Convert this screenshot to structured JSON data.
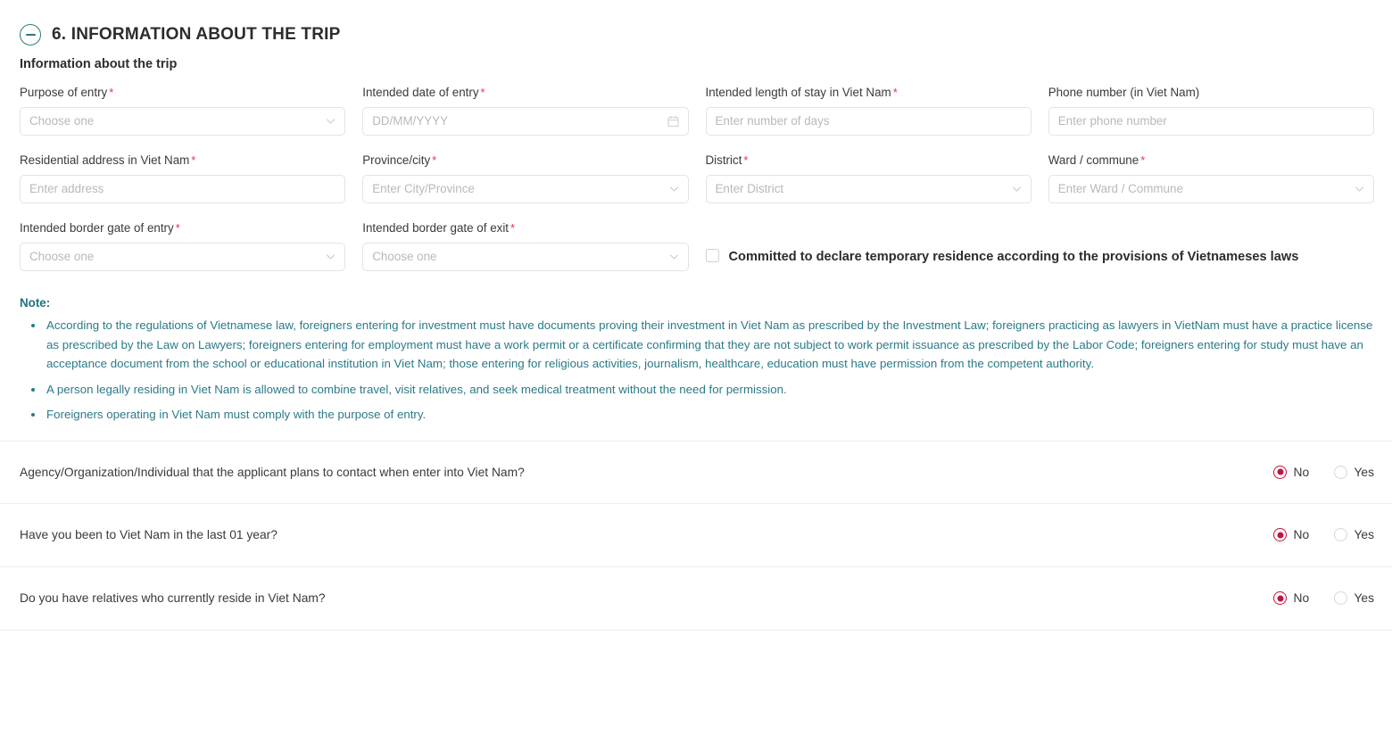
{
  "section": {
    "number_title": "6. INFORMATION ABOUT THE TRIP",
    "collapse_icon": "circle-minus-icon",
    "accent_color": "#2c7a7b",
    "subtitle": "Information about the trip"
  },
  "fields": [
    {
      "label": "Purpose of entry",
      "required": true,
      "type": "select",
      "placeholder": "Choose one",
      "value": "",
      "name": "purpose-of-entry"
    },
    {
      "label": "Intended date of entry",
      "required": true,
      "type": "date",
      "placeholder": "DD/MM/YYYY",
      "value": "",
      "name": "intended-date-of-entry"
    },
    {
      "label": "Intended length of stay in Viet Nam",
      "required": true,
      "type": "text",
      "placeholder": "Enter number of days",
      "value": "",
      "name": "intended-length-of-stay"
    },
    {
      "label": "Phone number (in Viet Nam)",
      "required": false,
      "type": "text",
      "placeholder": "Enter phone number",
      "value": "",
      "name": "phone-number-in-viet-nam"
    },
    {
      "label": "Residential address in Viet Nam",
      "required": true,
      "type": "text",
      "placeholder": "Enter address",
      "value": "",
      "name": "residential-address"
    },
    {
      "label": "Province/city",
      "required": true,
      "type": "select",
      "placeholder": "Enter City/Province",
      "value": "",
      "name": "province-city"
    },
    {
      "label": "District",
      "required": true,
      "type": "select",
      "placeholder": "Enter District",
      "value": "",
      "name": "district"
    },
    {
      "label": "Ward / commune",
      "required": true,
      "type": "select",
      "placeholder": "Enter Ward / Commune",
      "value": "",
      "name": "ward-commune"
    },
    {
      "label": "Intended border gate of entry",
      "required": true,
      "type": "select",
      "placeholder": "Choose one",
      "value": "",
      "name": "border-gate-of-entry"
    },
    {
      "label": "Intended border gate of exit",
      "required": true,
      "type": "select",
      "placeholder": "Choose one",
      "value": "",
      "name": "border-gate-of-exit"
    }
  ],
  "commitment": {
    "label": "Committed to declare temporary residence according to the provisions of Vietnameses laws",
    "checked": false
  },
  "note": {
    "title": "Note:",
    "color": "#2b7a88",
    "items": [
      "According to the regulations of Vietnamese law, foreigners entering for investment must have documents proving their investment in Viet Nam as prescribed by the Investment Law; foreigners practicing as lawyers in VietNam must have a practice license as prescribed by the Law on Lawyers; foreigners entering for employment must have a work permit or a certificate confirming that they are not subject to work permit issuance as prescribed by the Labor Code; foreigners entering for study must have an acceptance document from the school or educational institution in Viet Nam; those entering for religious activities, journalism, healthcare, education must have permission from the competent authority.",
      "A person legally residing in Viet Nam is allowed to combine travel, visit relatives, and seek medical treatment without the need for permission.",
      "Foreigners operating in Viet Nam must comply with the purpose of entry."
    ]
  },
  "questions": [
    {
      "text": "Agency/Organization/Individual that the applicant plans to contact when enter into Viet Nam?",
      "name": "question-agency-contact",
      "no_label": "No",
      "yes_label": "Yes",
      "selected": "No"
    },
    {
      "text": "Have you been to Viet Nam in the last 01 year?",
      "name": "question-been-to-viet-nam",
      "no_label": "No",
      "yes_label": "Yes",
      "selected": "No"
    },
    {
      "text": "Do you have relatives who currently reside in Viet Nam?",
      "name": "question-relatives-reside",
      "no_label": "No",
      "yes_label": "Yes",
      "selected": "No"
    }
  ],
  "colors": {
    "required_asterisk": "#e8334a",
    "radio_selected": "#c4123f",
    "note_text": "#2b7a88",
    "toggle": "#2c7a7b",
    "border": "#e3e3e6"
  }
}
